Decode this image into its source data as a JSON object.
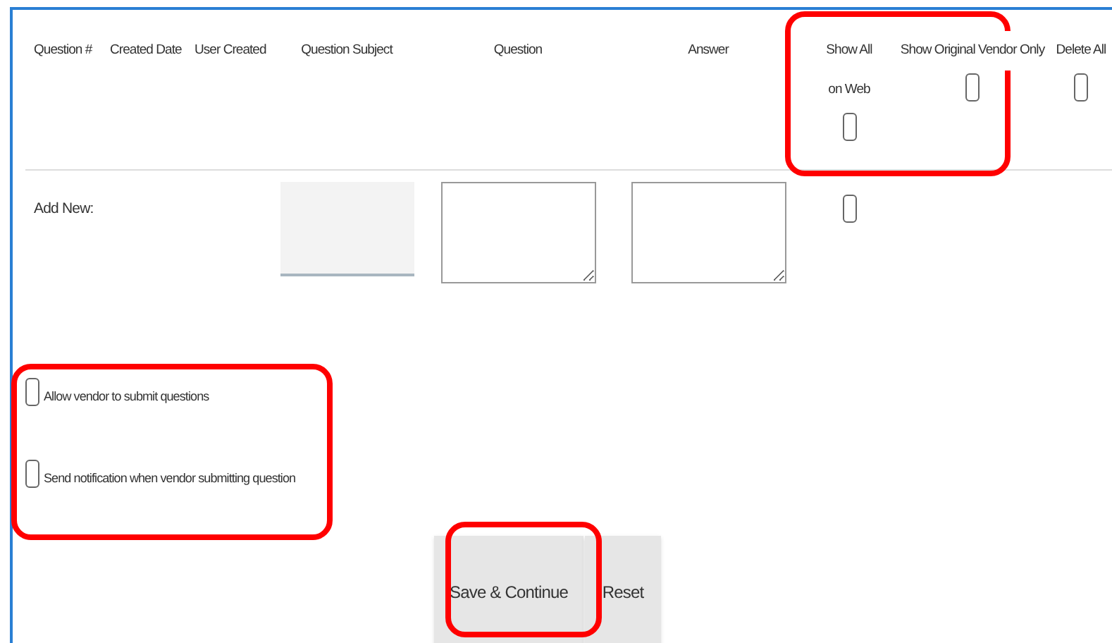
{
  "columns": [
    {
      "label": "Question #",
      "kind": "text"
    },
    {
      "label": "Created Date",
      "kind": "text"
    },
    {
      "label": "User Created",
      "kind": "text"
    },
    {
      "label": "Question Subject",
      "kind": "text"
    },
    {
      "label": "Question",
      "kind": "text"
    },
    {
      "label": "Answer",
      "kind": "text"
    },
    {
      "label": "Show All on Web",
      "kind": "checkbox",
      "checked": false
    },
    {
      "label": "Show Original Vendor Only",
      "kind": "checkbox",
      "checked": false
    },
    {
      "label": "Delete All",
      "kind": "checkbox",
      "checked": false
    }
  ],
  "add_new": {
    "label": "Add New:",
    "show_on_web_checked": false
  },
  "options": [
    {
      "label": "Allow vendor to submit questions",
      "checked": false
    },
    {
      "label": "Send notification when vendor submitting question",
      "checked": false
    }
  ],
  "buttons": [
    {
      "label": "Save & Continue"
    },
    {
      "label": "Reset"
    }
  ],
  "highlight_frames": [
    {
      "kind": "header_checkboxes"
    },
    {
      "kind": "options"
    },
    {
      "kind": "save_button"
    }
  ]
}
